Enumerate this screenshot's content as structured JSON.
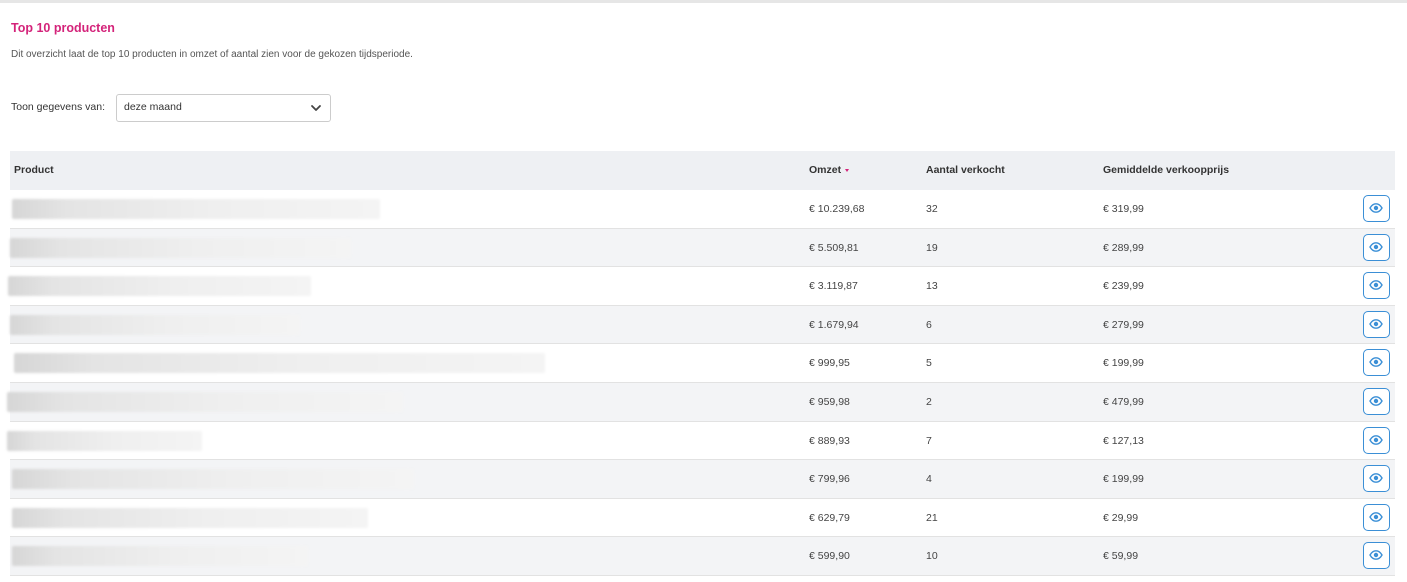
{
  "header": {
    "title": "Top 10 producten",
    "description": "Dit overzicht laat de top 10 producten in omzet of aantal zien voor de gekozen tijdsperiode."
  },
  "filter": {
    "label": "Toon gegevens van:",
    "selected": "deze maand"
  },
  "table": {
    "columns": {
      "product": "Product",
      "omzet": "Omzet",
      "aantal": "Aantal verkocht",
      "gemiddelde": "Gemiddelde verkoopprijs"
    },
    "sort_column": "Omzet",
    "rows": [
      {
        "omzet": "€ 10.239,68",
        "aantal": "32",
        "gemiddelde": "€ 319,99"
      },
      {
        "omzet": "€ 5.509,81",
        "aantal": "19",
        "gemiddelde": "€ 289,99"
      },
      {
        "omzet": "€ 3.119,87",
        "aantal": "13",
        "gemiddelde": "€ 239,99"
      },
      {
        "omzet": "€ 1.679,94",
        "aantal": "6",
        "gemiddelde": "€ 279,99"
      },
      {
        "omzet": "€ 999,95",
        "aantal": "5",
        "gemiddelde": "€ 199,99"
      },
      {
        "omzet": "€ 959,98",
        "aantal": "2",
        "gemiddelde": "€ 479,99"
      },
      {
        "omzet": "€ 889,93",
        "aantal": "7",
        "gemiddelde": "€ 127,13"
      },
      {
        "omzet": "€ 799,96",
        "aantal": "4",
        "gemiddelde": "€ 199,99"
      },
      {
        "omzet": "€ 629,79",
        "aantal": "21",
        "gemiddelde": "€ 29,99"
      },
      {
        "omzet": "€ 599,90",
        "aantal": "10",
        "gemiddelde": "€ 59,99"
      }
    ]
  },
  "icons": {
    "view": "eye-icon",
    "select": "chevron-down-icon"
  },
  "colors": {
    "title": "#d4237a",
    "accent": "#3b8fd6"
  }
}
